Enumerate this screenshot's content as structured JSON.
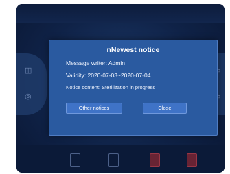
{
  "dialog": {
    "title": "nNewest notice",
    "message_writer": "Message writer:  Admin",
    "validity": "Validity:  2020-07-03~2020-07-04",
    "notice_content": "Notice content:  Sterilization in progress",
    "buttons": {
      "other_notices": "Other notices",
      "close": "Close"
    }
  },
  "colors": {
    "device_background": "#0f2247",
    "dialog_background": "#2a5aa0",
    "button_background": "#3f73c7",
    "dialog_text": "#ffffff"
  }
}
